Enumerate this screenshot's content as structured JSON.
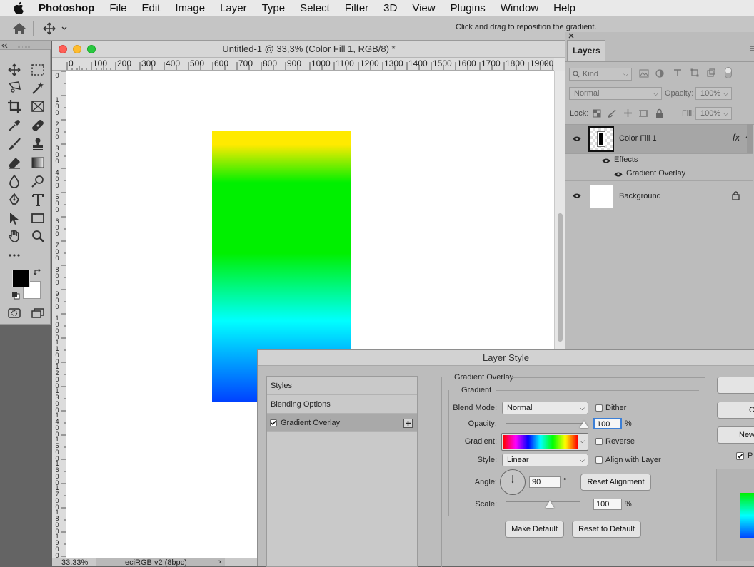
{
  "menubar": {
    "app_name": "Photoshop",
    "items": [
      "File",
      "Edit",
      "Image",
      "Layer",
      "Type",
      "Select",
      "Filter",
      "3D",
      "View",
      "Plugins",
      "Window",
      "Help"
    ]
  },
  "options_bar": {
    "hint": "Click and drag to reposition the gradient."
  },
  "document": {
    "title": "Untitled-1 @ 33,3% (Color Fill 1, RGB/8) *",
    "ruler_h": [
      "0",
      "100",
      "200",
      "300",
      "400",
      "500",
      "600",
      "700",
      "800",
      "900",
      "1000",
      "1100",
      "1200",
      "1300",
      "1400",
      "1500",
      "1600",
      "1700",
      "1800",
      "1900",
      "20"
    ],
    "ruler_v": [
      "0",
      "1 0 0",
      "2 0 0",
      "3 0 0",
      "4 0 0",
      "5 0 0",
      "6 0 0",
      "7 0 0",
      "8 0 0",
      "9 0 0",
      "1 0 0 0",
      "1 1 0 0",
      "1 2 0 0",
      "1 3 0 0",
      "1 4 0 0",
      "1 5 0 0",
      "1 6 0 0",
      "1 7 0 0",
      "1 8 0 0",
      "1 9 0 0"
    ],
    "zoom": "33.33%",
    "profile": "eciRGB v2 (8bpc)",
    "gradient_colors": [
      "#ffea00",
      "#00f000",
      "#00ffff",
      "#0040ff"
    ]
  },
  "layers_panel": {
    "tab": "Layers",
    "filter_kind": "Kind",
    "blend_mode": "Normal",
    "opacity_label": "Opacity:",
    "opacity_value": "100%",
    "lock_label": "Lock:",
    "fill_label": "Fill:",
    "fill_value": "100%",
    "layers": [
      {
        "name": "Color Fill 1",
        "effects_label": "Effects",
        "effect": "Gradient Overlay",
        "fx": "fx"
      },
      {
        "name": "Background"
      }
    ]
  },
  "layer_style": {
    "title": "Layer Style",
    "list": [
      "Styles",
      "Blending Options",
      "Gradient Overlay"
    ],
    "section": "Gradient Overlay",
    "group": "Gradient",
    "blend_mode_label": "Blend Mode:",
    "blend_mode": "Normal",
    "dither_label": "Dither",
    "opacity_label": "Opacity:",
    "opacity": "100",
    "opacity_unit": "%",
    "gradient_label": "Gradient:",
    "reverse_label": "Reverse",
    "style_label": "Style:",
    "style": "Linear",
    "align_label": "Align with Layer",
    "angle_label": "Angle:",
    "angle": "90",
    "angle_unit": "°",
    "reset_alignment": "Reset Alignment",
    "scale_label": "Scale:",
    "scale": "100",
    "scale_unit": "%",
    "make_default": "Make Default",
    "reset_default": "Reset to Default",
    "right_btn_2": "C",
    "right_btn_3": "New",
    "preview_label": "P",
    "opacity_slider": 1.0,
    "scale_slider": 0.6
  }
}
